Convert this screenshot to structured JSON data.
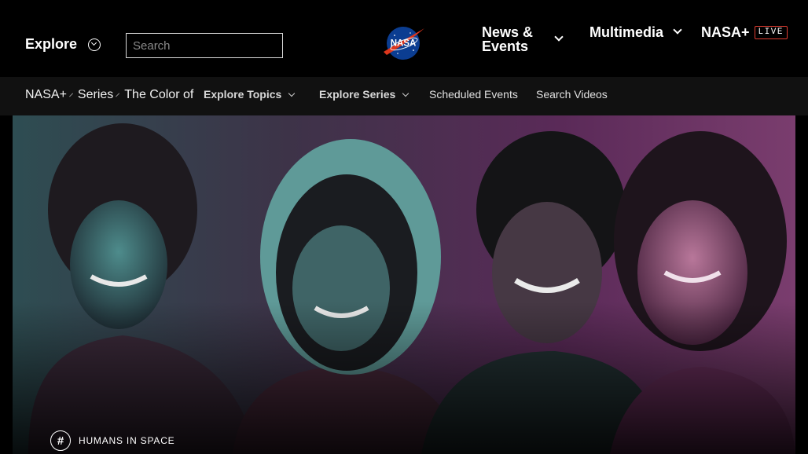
{
  "header": {
    "explore_label": "Explore",
    "search_placeholder": "Search",
    "logo_text": "NASA",
    "nav": {
      "news_label": "News & Events",
      "multimedia_label": "Multimedia",
      "nasa_plus_label": "NASA+",
      "live_badge": "LIVE"
    }
  },
  "subnav": {
    "breadcrumbs": [
      "NASA+",
      "Series",
      "The Color of Space"
    ],
    "links": {
      "explore_topics": "Explore Topics",
      "explore_series": "Explore Series",
      "scheduled_events": "Scheduled Events",
      "search_videos": "Search Videos"
    }
  },
  "hero": {
    "topic_icon": "#",
    "topic_label": "HUMANS IN SPACE"
  },
  "colors": {
    "background": "#000000",
    "subnav_bg": "#111111",
    "live_accent": "#e03c31",
    "nasa_blue": "#0b3d91"
  }
}
